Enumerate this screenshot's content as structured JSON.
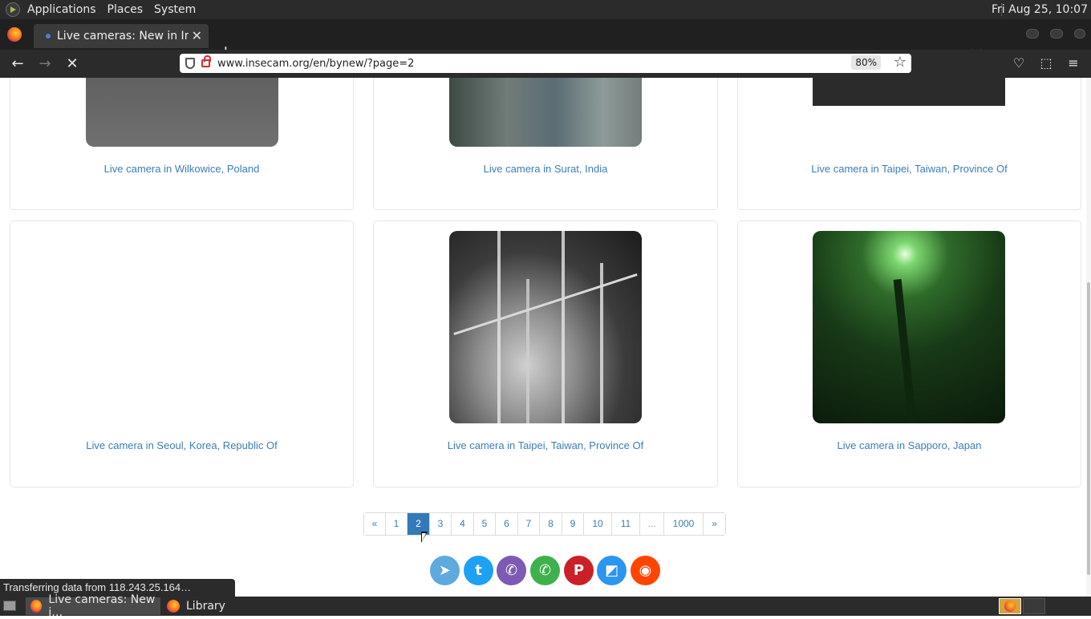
{
  "top_panel": {
    "menus": [
      "Applications",
      "Places",
      "System"
    ],
    "clock": "Fri Aug 25, 10:07"
  },
  "browser": {
    "tab_title": "Live cameras: New in Insecam",
    "url": "www.insecam.org/en/bynew/?page=2",
    "zoom": "80%"
  },
  "cameras": [
    {
      "caption": "Live camera in Wilkowice, Poland"
    },
    {
      "caption": "Live camera in Surat, India"
    },
    {
      "caption": "Live camera in Taipei, Taiwan, Province Of"
    },
    {
      "caption": "Live camera in Seoul, Korea, Republic Of"
    },
    {
      "caption": "Live camera in Taipei, Taiwan, Province Of"
    },
    {
      "caption": "Live camera in Sapporo, Japan"
    }
  ],
  "pagination": {
    "prev": "«",
    "pages": [
      "1",
      "2",
      "3",
      "4",
      "5",
      "6",
      "7",
      "8",
      "9",
      "10",
      "11",
      "...",
      "1000"
    ],
    "next": "»",
    "current": "2"
  },
  "share_buttons": [
    {
      "name": "telegram",
      "color": "#5ea9dd"
    },
    {
      "name": "twitter",
      "color": "#1da1f2"
    },
    {
      "name": "viber",
      "color": "#7d5ab3"
    },
    {
      "name": "whatsapp",
      "color": "#3fb14c"
    },
    {
      "name": "pinterest",
      "color": "#cb2027"
    },
    {
      "name": "delicious",
      "color": "#2a96ee"
    },
    {
      "name": "reddit",
      "color": "#ff4500"
    }
  ],
  "status_bar": "Transferring data from 118.243.25.164…",
  "taskbar": {
    "tasks": [
      "Live cameras: New i…",
      "Library"
    ]
  }
}
